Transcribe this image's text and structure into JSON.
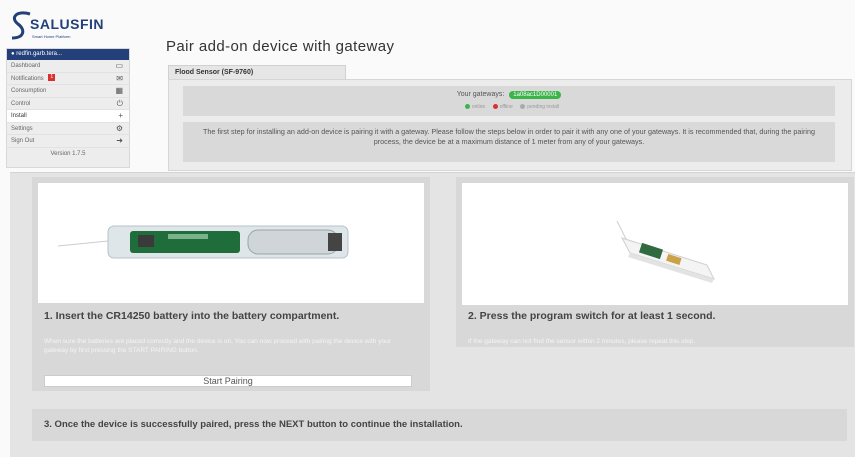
{
  "logo": {
    "text": "SALUSFIN",
    "sub": "Smart Home Platform"
  },
  "sidebar": {
    "user": "redfin.garb.tera...",
    "items": [
      {
        "label": "Dashboard",
        "icon": "monitor-icon"
      },
      {
        "label": "Notifications",
        "badge": "1",
        "icon": "envelope-icon"
      },
      {
        "label": "Consumption",
        "icon": "calendar-icon"
      },
      {
        "label": "Control",
        "icon": "power-icon"
      },
      {
        "label": "Install",
        "icon": "plus-icon"
      },
      {
        "label": "Settings",
        "icon": "gear-icon"
      },
      {
        "label": "Sign Out",
        "icon": "signout-icon"
      }
    ],
    "version": "Version 1.7.5"
  },
  "page_title": "Pair add-on device with gateway",
  "device_tab": "Flood Sensor (SF-9760)",
  "gateways": {
    "label": "Your gateways:",
    "chip": "1a08ac1D00001",
    "legend": [
      "online",
      "offline",
      "pending install"
    ],
    "colors": {
      "online": "#3bb44a",
      "offline": "#d93030",
      "pending": "#aaaaaa"
    }
  },
  "info_text": "The first step for installing an add-on device is pairing it with a gateway. Please follow the steps below in order to pair it with any one of your gateways. It is recommended that, during the pairing process, the device be at a maximum distance of 1 meter from any of your gateways.",
  "steps": [
    {
      "heading": "1. Insert the CR14250 battery into the battery compartment.",
      "desc": "When sure the batteries are placed correctly and the device is on. You can now proceed with pairing the device with your gateway by first pressing the START PAIRING button.",
      "button": "Start Pairing"
    },
    {
      "heading": "2. Press the program switch for at least 1 second.",
      "desc": "If the gateway can not find the sensor within 2 minutes, please repeat this step."
    },
    {
      "heading": "3. Once the device is successfully paired, press the NEXT button to continue the installation."
    }
  ]
}
